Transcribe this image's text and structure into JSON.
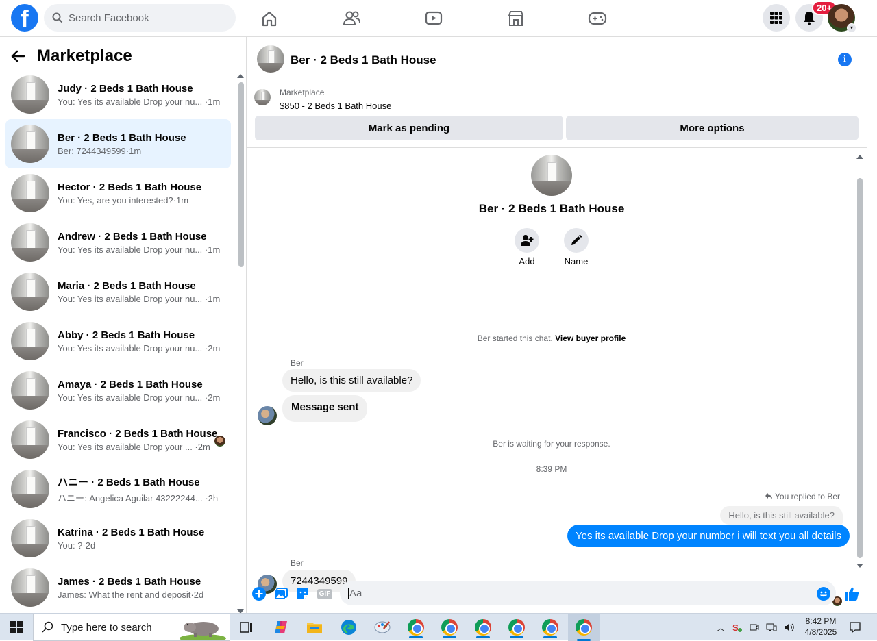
{
  "topbar": {
    "logo": "f",
    "search_placeholder": "Search Facebook",
    "nav_icons": [
      "home-icon",
      "friends-icon",
      "watch-icon",
      "marketplace-icon",
      "gaming-icon"
    ],
    "notifications_badge": "20+"
  },
  "sidebar": {
    "title": "Marketplace",
    "conversations": [
      {
        "name": "Judy · 2 Beds 1 Bath House",
        "preview": "You: Yes its available Drop your nu... ·1m"
      },
      {
        "name": "Ber · 2 Beds 1 Bath House",
        "preview": "Ber: 7244349599·1m"
      },
      {
        "name": "Hector · 2 Beds 1 Bath House",
        "preview": "You: Yes, are you interested?·1m"
      },
      {
        "name": "Andrew · 2 Beds 1 Bath House",
        "preview": "You: Yes its available Drop your nu... ·1m"
      },
      {
        "name": "Maria · 2 Beds 1 Bath House",
        "preview": "You: Yes its available Drop your nu... ·1m"
      },
      {
        "name": "Abby · 2 Beds 1 Bath House",
        "preview": "You: Yes its available Drop your nu... ·2m"
      },
      {
        "name": "Amaya · 2 Beds 1 Bath House",
        "preview": "You: Yes its available Drop your nu... ·2m"
      },
      {
        "name": "Francisco · 2 Beds 1 Bath House",
        "preview": "You: Yes its available Drop your ... ·2m"
      },
      {
        "name": "ハニー · 2 Beds 1 Bath House",
        "preview": "ハニー: Angelica Aguilar 43222244... ·2h"
      },
      {
        "name": "Katrina · 2 Beds 1 Bath House",
        "preview": "You: ?·2d"
      },
      {
        "name": "James · 2 Beds 1 Bath House",
        "preview": "James: What the rent and deposit·2d"
      }
    ]
  },
  "chat": {
    "header_name": "Ber · 2 Beds 1 Bath House",
    "listing_label": "Marketplace",
    "listing_title": "$850 - 2 Beds 1 Bath House",
    "mark_pending": "Mark as pending",
    "more_options": "More options",
    "center_name": "Ber · 2 Beds 1 Bath House",
    "action_add": "Add",
    "action_name": "Name",
    "started_text": "Ber started this chat.",
    "view_profile": "View buyer profile",
    "sender1": "Ber",
    "msg1": "Hello, is this still available?",
    "msg2": "Message sent",
    "waiting": "Ber is waiting for your response.",
    "time": "8:39 PM",
    "replied_note": "You replied to Ber",
    "quoted": "Hello, is this still available?",
    "outgoing": "Yes its available Drop your number i will text you all details",
    "sender2": "Ber",
    "msg3": "7244349599",
    "composer_placeholder": "Aa",
    "composer_gif": "GIF"
  },
  "taskbar": {
    "search_placeholder": "Type here to search",
    "time": "8:42 PM",
    "date": "4/8/2025"
  },
  "colors": {
    "brand": "#1877f2",
    "outgoing_bubble": "#0084ff",
    "active_row": "#e7f3ff"
  }
}
